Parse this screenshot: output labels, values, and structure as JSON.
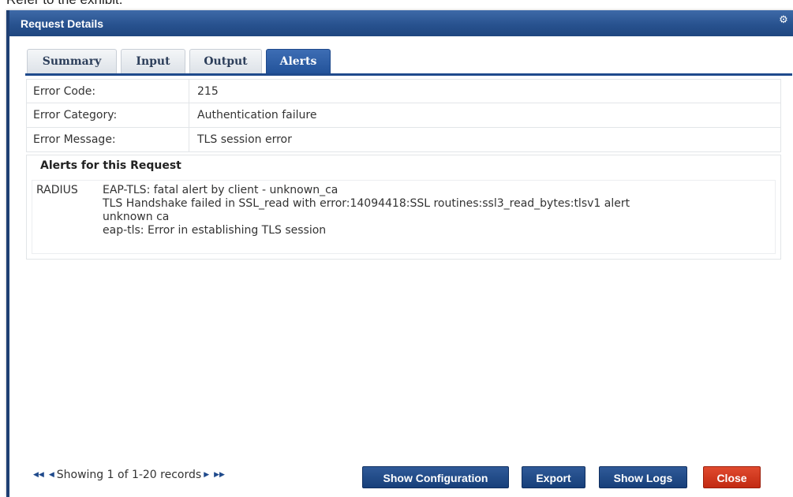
{
  "caption": "Refer to the exhibit.",
  "dialog": {
    "title": "Request Details",
    "settings_icon": "gear-icon"
  },
  "tabs": [
    {
      "label": "Summary",
      "active": false
    },
    {
      "label": "Input",
      "active": false
    },
    {
      "label": "Output",
      "active": false
    },
    {
      "label": "Alerts",
      "active": true
    }
  ],
  "details": [
    {
      "label": "Error Code:",
      "value": "215"
    },
    {
      "label": "Error Category:",
      "value": "Authentication failure"
    },
    {
      "label": "Error Message:",
      "value": "TLS session error"
    }
  ],
  "alerts": {
    "heading": "Alerts for this Request",
    "source": "RADIUS",
    "lines": [
      "EAP-TLS: fatal alert by client - unknown_ca",
      "TLS Handshake failed in SSL_read with error:14094418:SSL routines:ssl3_read_bytes:tlsv1 alert",
      "unknown ca",
      "eap-tls: Error in establishing TLS session"
    ]
  },
  "footer": {
    "pager_text": "Showing 1 of 1-20 records",
    "buttons": {
      "show_configuration": "Show Configuration",
      "export": "Export",
      "show_logs": "Show Logs",
      "close": "Close"
    },
    "colors": {
      "primary": "#1f4a8c",
      "danger": "#d1361c"
    }
  }
}
